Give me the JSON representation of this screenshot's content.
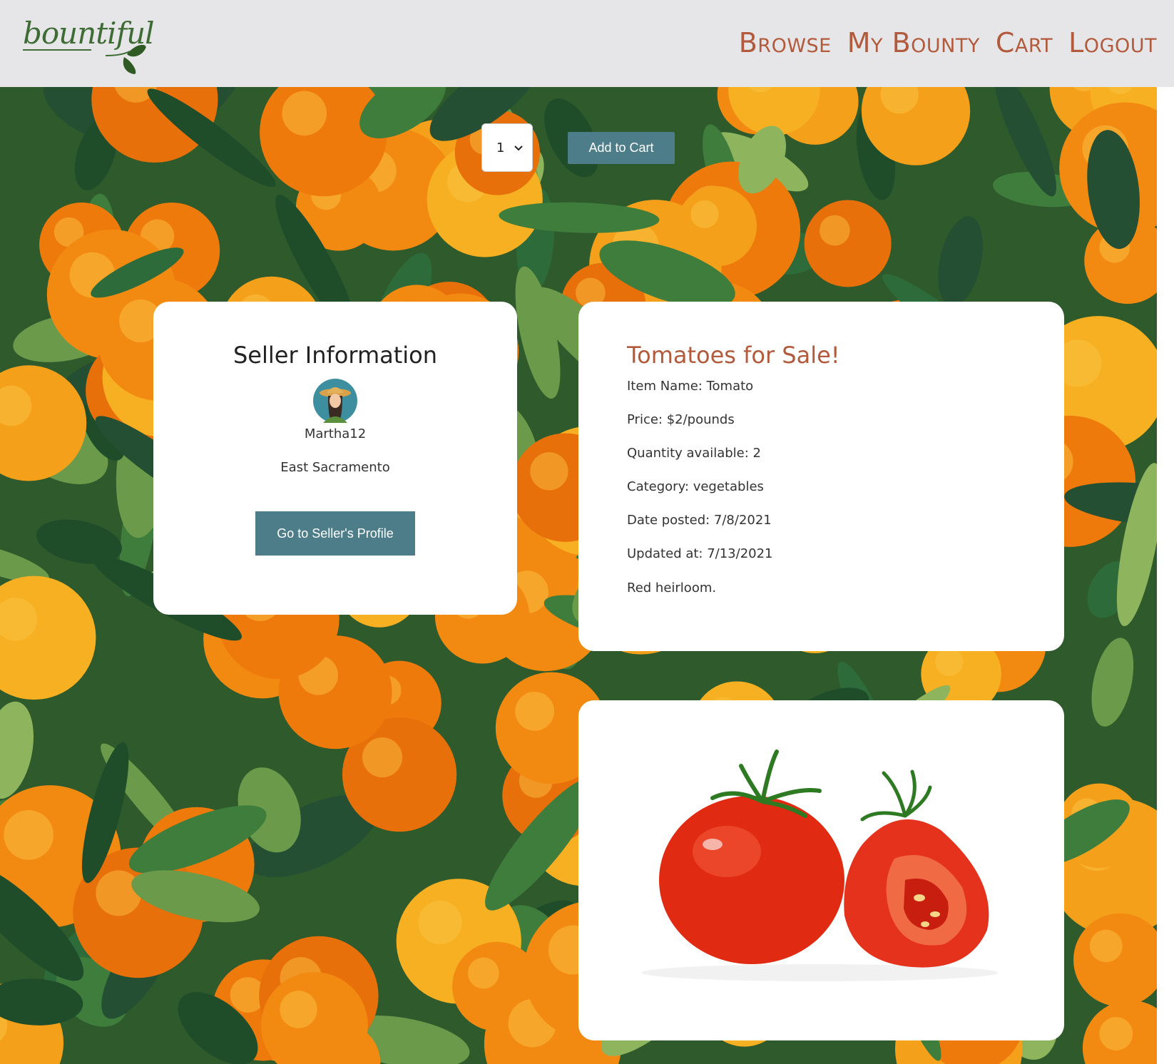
{
  "brand": {
    "logo_text": "bountiful"
  },
  "nav": {
    "browse": "Browse",
    "my_bounty": "My Bounty",
    "cart": "Cart",
    "logout": "Logout"
  },
  "purchase": {
    "quantity_selected": "1",
    "add_to_cart": "Add to Cart"
  },
  "seller": {
    "title": "Seller Information",
    "username": "Martha12",
    "location": "East Sacramento",
    "profile_button": "Go to Seller's Profile"
  },
  "item": {
    "title": "Tomatoes for Sale!",
    "name_line": "Item Name: Tomato",
    "price_line": "Price: $2/pounds",
    "quantity_line": "Quantity available: 2",
    "category_line": "Category: vegetables",
    "posted_line": "Date posted: 7/8/2021",
    "updated_line": "Updated at: 7/13/2021",
    "description": "Red heirloom."
  },
  "colors": {
    "accent": "#b25a3c",
    "button": "#4e7d8a",
    "header_bg": "#e6e6e8",
    "logo_green": "#3f6b35"
  }
}
